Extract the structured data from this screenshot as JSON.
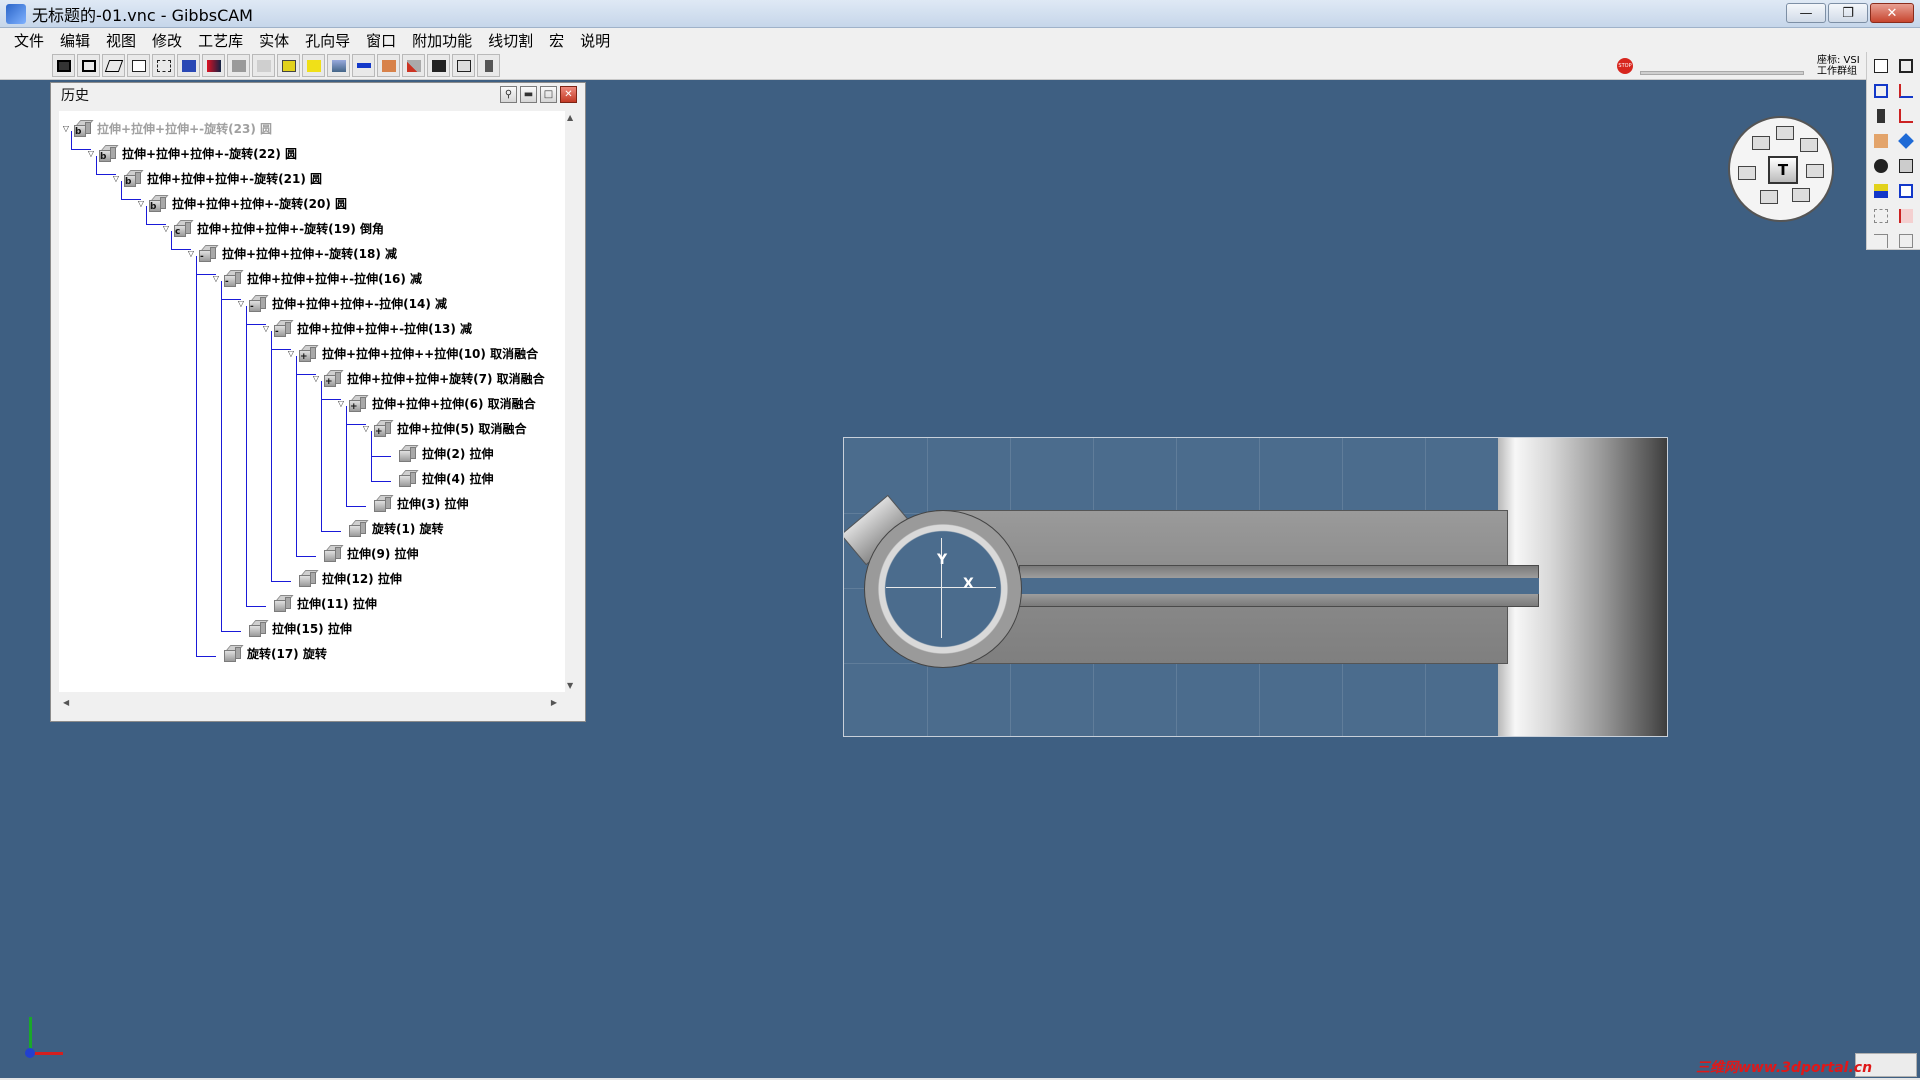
{
  "window": {
    "title": "无标题的-01.vnc - GibbsCAM",
    "buttons": {
      "minimize": "—",
      "restore": "❐",
      "close": "✕"
    }
  },
  "menu": [
    "文件",
    "编辑",
    "视图",
    "修改",
    "工艺库",
    "实体",
    "孔向导",
    "窗口",
    "附加功能",
    "线切割",
    "宏",
    "说明"
  ],
  "status_bar": {
    "coord_label": "座标: VSI 工作群组"
  },
  "history": {
    "title": "历史",
    "nodes": [
      {
        "label": "拉伸+拉伸+拉伸+-旋转(23) 圆",
        "badge": "b",
        "dim": true
      },
      {
        "label": "拉伸+拉伸+拉伸+-旋转(22) 圆",
        "badge": "b"
      },
      {
        "label": "拉伸+拉伸+拉伸+-旋转(21) 圆",
        "badge": "b"
      },
      {
        "label": "拉伸+拉伸+拉伸+-旋转(20) 圆",
        "badge": "b"
      },
      {
        "label": "拉伸+拉伸+拉伸+-旋转(19) 倒角",
        "badge": "c"
      },
      {
        "label": "拉伸+拉伸+拉伸+-旋转(18) 减",
        "badge": "-"
      },
      {
        "label": "拉伸+拉伸+拉伸+-拉伸(16) 减",
        "badge": "-"
      },
      {
        "label": "拉伸+拉伸+拉伸+-拉伸(14) 减",
        "badge": "-"
      },
      {
        "label": "拉伸+拉伸+拉伸+-拉伸(13) 减",
        "badge": "-"
      },
      {
        "label": "拉伸+拉伸+拉伸++拉伸(10) 取消融合",
        "badge": "+"
      },
      {
        "label": "拉伸+拉伸+拉伸+旋转(7) 取消融合",
        "badge": "+"
      },
      {
        "label": "拉伸+拉伸+拉伸(6) 取消融合",
        "badge": "+"
      },
      {
        "label": "拉伸+拉伸(5) 取消融合",
        "badge": "+"
      },
      {
        "label": "拉伸(2) 拉伸",
        "badge": ""
      },
      {
        "label": "拉伸(4) 拉伸",
        "badge": ""
      },
      {
        "label": "拉伸(3) 拉伸",
        "badge": ""
      },
      {
        "label": "旋转(1) 旋转",
        "badge": ""
      },
      {
        "label": "拉伸(9) 拉伸",
        "badge": ""
      },
      {
        "label": "拉伸(12) 拉伸",
        "badge": ""
      },
      {
        "label": "拉伸(11) 拉伸",
        "badge": ""
      },
      {
        "label": "拉伸(15) 拉伸",
        "badge": ""
      },
      {
        "label": "旋转(17) 旋转",
        "badge": ""
      }
    ]
  },
  "viewport": {
    "axis_x": "X",
    "axis_y": "Y",
    "navigator_label": "T"
  },
  "watermark": "三维网www.3dportal.cn",
  "colors": {
    "background": "#3e5f82",
    "tree_line": "#1a1ad8",
    "watermark": "#e01818"
  }
}
